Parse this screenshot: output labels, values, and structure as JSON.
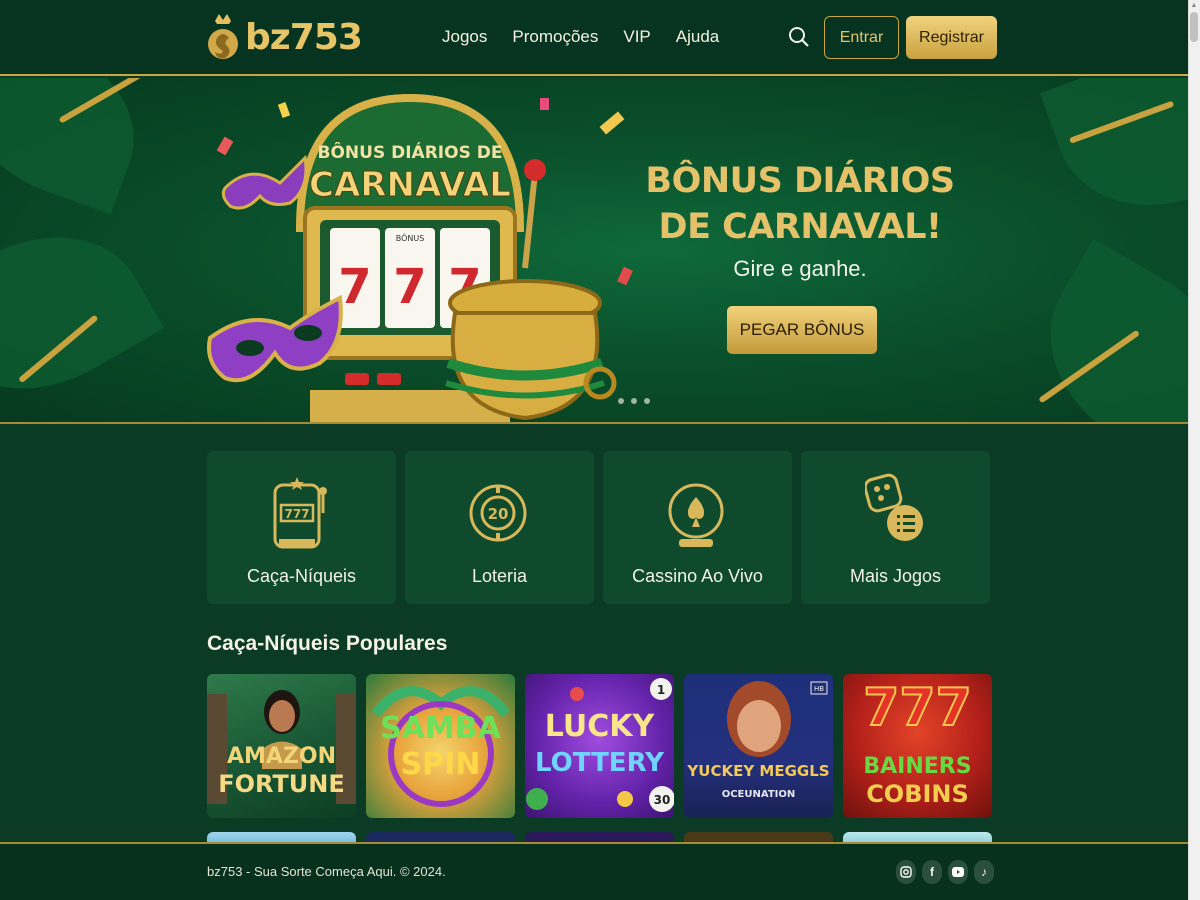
{
  "brand": {
    "name": "bz753"
  },
  "nav": {
    "items": [
      "Jogos",
      "Promoções",
      "VIP",
      "Ajuda"
    ]
  },
  "header": {
    "login_label": "Entrar",
    "register_label": "Registrar",
    "search_icon": "search-icon"
  },
  "banner": {
    "image_title_line1": "BÔNUS DIÁRIOS DE",
    "image_title_line2": "CARNAVAL",
    "title": "BÔNUS DIÁRIOS DE CARNAVAL!",
    "subtitle": "Gire e ganhe.",
    "cta_label": "PEGAR BÔNUS",
    "slot_reel_symbol": "7",
    "slot_reel_sign": "BÔNUS",
    "slides_count": 3
  },
  "categories": [
    {
      "label": "Caça-Níqueis",
      "icon": "slot-machine-icon"
    },
    {
      "label": "Loteria",
      "icon": "lottery-ball-icon",
      "icon_text": "20"
    },
    {
      "label": "Cassino Ao Vivo",
      "icon": "live-casino-icon"
    },
    {
      "label": "Mais Jogos",
      "icon": "more-games-icon"
    }
  ],
  "popular": {
    "title": "Caça-Níqueis Populares",
    "games": [
      {
        "title_line1": "AMAZON",
        "title_line2": "FORTUNE"
      },
      {
        "title_line1": "SAMBA",
        "title_line2": "SPIN"
      },
      {
        "title_line1": "LUCKY",
        "title_line2": "LOTTERY",
        "balls": [
          "1",
          "30"
        ]
      },
      {
        "title_line1": "YUCKEY MEGGLS",
        "title_line2": "OCEUNATION",
        "badge": "HB"
      },
      {
        "title_line1": "777",
        "title_line2": "BAINERS",
        "title_line3": "COBINS"
      }
    ]
  },
  "footer": {
    "text": "bz753 - Sua Sorte Começa Aqui. © 2024.",
    "socials": [
      "instagram-icon",
      "facebook-icon",
      "youtube-icon",
      "tiktok-icon"
    ]
  },
  "colors": {
    "gold": "#c9a640",
    "bg": "#0b3a25",
    "card": "#0f4a2d"
  }
}
